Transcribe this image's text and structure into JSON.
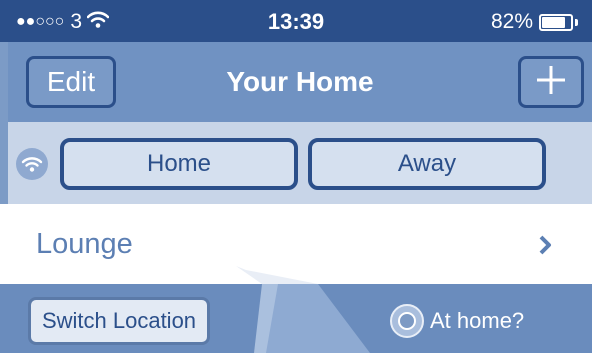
{
  "status_bar": {
    "signal_dots": "●●○○○",
    "carrier": "3",
    "time": "13:39",
    "battery_percent": "82%",
    "battery_level": 0.82,
    "wifi_icon": "wifi-icon"
  },
  "nav": {
    "edit_label": "Edit",
    "title": "Your Home",
    "add_icon": "plus-icon"
  },
  "mode": {
    "home_label": "Home",
    "away_label": "Away",
    "wifi_icon": "wifi-icon"
  },
  "location": {
    "label": "Lounge",
    "chevron_icon": "chevron-right-icon"
  },
  "bottom": {
    "switch_label": "Switch Location",
    "at_home_label": "At home?"
  },
  "colors": {
    "status_bar": "#2b4f8a",
    "nav_bar": "#7092c2",
    "mode_bar": "#c8d5e8",
    "accent": "#2b4f8a",
    "location_text": "#5c7fb3",
    "bottom_bar": "#6a8cbd"
  }
}
